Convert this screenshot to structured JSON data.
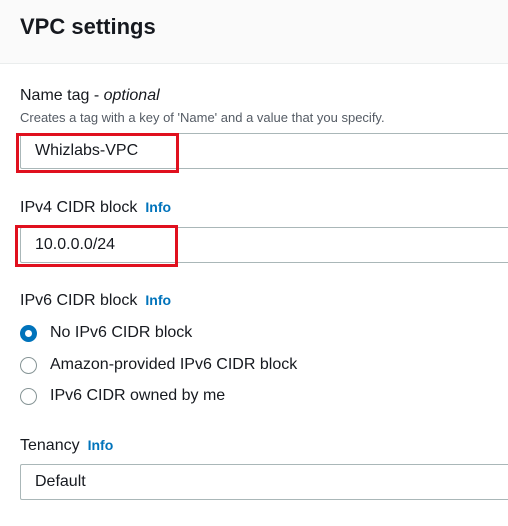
{
  "section": {
    "title": "VPC settings"
  },
  "name_tag": {
    "label": "Name tag - ",
    "optional": "optional",
    "description": "Creates a tag with a key of 'Name' and a value that you specify.",
    "value": "Whizlabs-VPC"
  },
  "ipv4": {
    "label": "IPv4 CIDR block",
    "info": "Info",
    "value": "10.0.0.0/24"
  },
  "ipv6": {
    "label": "IPv6 CIDR block",
    "info": "Info",
    "options": [
      {
        "label": "No IPv6 CIDR block",
        "checked": true
      },
      {
        "label": "Amazon-provided IPv6 CIDR block",
        "checked": false
      },
      {
        "label": "IPv6 CIDR owned by me",
        "checked": false
      }
    ]
  },
  "tenancy": {
    "label": "Tenancy",
    "info": "Info",
    "value": "Default"
  },
  "colors": {
    "accent": "#0073bb",
    "highlight": "#e0101e"
  }
}
